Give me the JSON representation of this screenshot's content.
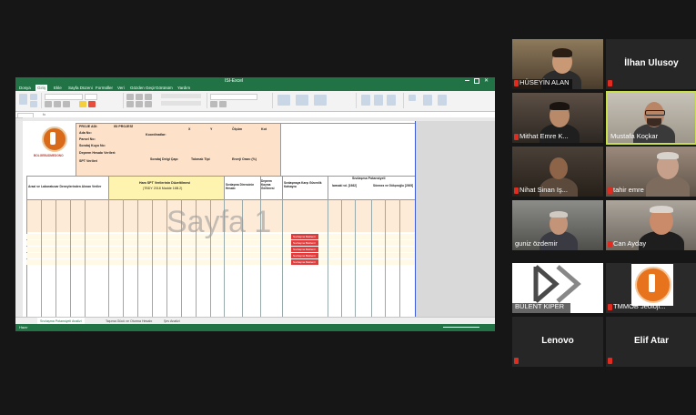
{
  "excel": {
    "title": "ISI-Excel",
    "menu": [
      "Dosya",
      "Giriş",
      "Ekle",
      "Sayfa Düzeni",
      "Formüller",
      "Veri",
      "Gözden Geçir",
      "Görünüm",
      "Yardım"
    ],
    "watermark": "Sayfa 1",
    "header": {
      "proje_adi_label": "PROJE ADI:",
      "proje_adi": "ISI PROJESİ",
      "ada_no_label": "Ada No:",
      "parsel_no_label": "Parsel No:",
      "sondaj_kuyu_label": "Sondaj Kuyu No:",
      "koordinatlar_label": "Koordinatlar:",
      "coord_x": "X",
      "coord_y": "Y",
      "olcum_label": "Ölçüm",
      "kot_label": "Kot",
      "deprem_label": "Deprem Hesabı Verileri:",
      "spt_label": "SPT Verileri",
      "sondaj_delgi_label": "Sondaj Delgi Çapı",
      "tokmak_label": "Tokmak Tipi",
      "enerji_label": "Enerji Oranı (%)",
      "logo_text": "BOLGEBUDMEDONO"
    },
    "section_titles": {
      "arazi": "Arazi ve Laboratuvar Deneylerinden Alınan Veriler",
      "ham_spt": "Ham SPT Verilerinin Düzeltilmesi",
      "ham_spt_sub": "(TBDY 2018 Madde 16B.2)",
      "sivilasma_direnc": "Sıvılaşma Direncinin Hesabı",
      "deprem_kayma": "Deprem Kayma Gerilmesi",
      "sivilasma_katsayisi": "Sıvılaşmaya Karşı Güvenlik Katsayısı",
      "sivilasma_potansiyeli": "Sıvılaşma Potansiyeli",
      "iwasaki": "Iwasaki vd. [1982]",
      "sonmez": "Sönmez ve Gökçeoğlu [2005]"
    },
    "result_label": "Sıvılaşma Beklenir",
    "sheet_tabs": [
      "Sıvılaşma Potansiyeli Analizi",
      "Taşıma Gücü ve Oturma Hesabı",
      "Şev Analizi"
    ],
    "status": "Hazır"
  },
  "participants": [
    {
      "name": "HÜSEYİN ALAN",
      "video": true,
      "muted": true,
      "speaking": false
    },
    {
      "name": "İlhan Ulusoy",
      "video": false,
      "muted": true,
      "speaking": false
    },
    {
      "name": "Mithat Emre K...",
      "video": true,
      "muted": true,
      "speaking": false
    },
    {
      "name": "Mustafa Koçkar",
      "video": true,
      "muted": false,
      "speaking": true
    },
    {
      "name": "Nihat Sinan Iş...",
      "video": true,
      "muted": true,
      "speaking": false
    },
    {
      "name": "tahir emre",
      "video": true,
      "muted": true,
      "speaking": false
    },
    {
      "name": "guniz özdemir",
      "video": true,
      "muted": false,
      "speaking": false
    },
    {
      "name": "Can Ayday",
      "video": true,
      "muted": true,
      "speaking": false
    },
    {
      "name": "BÜLENT KIPER",
      "video": true,
      "muted": false,
      "speaking": false
    },
    {
      "name": "TMMOB Jeoloji...",
      "video": true,
      "muted": true,
      "speaking": false
    },
    {
      "name": "Lenovo",
      "video": false,
      "muted": true,
      "speaking": false
    },
    {
      "name": "Elif Atar",
      "video": false,
      "muted": true,
      "speaking": false
    }
  ],
  "colors": {
    "excel_green": "#217346",
    "speaker_border": "#c9e04a",
    "mic_muted": "#e02b20",
    "header_orange": "#fde1c8",
    "header_yellow": "#fff3b0",
    "result_red": "#e23b3b"
  }
}
